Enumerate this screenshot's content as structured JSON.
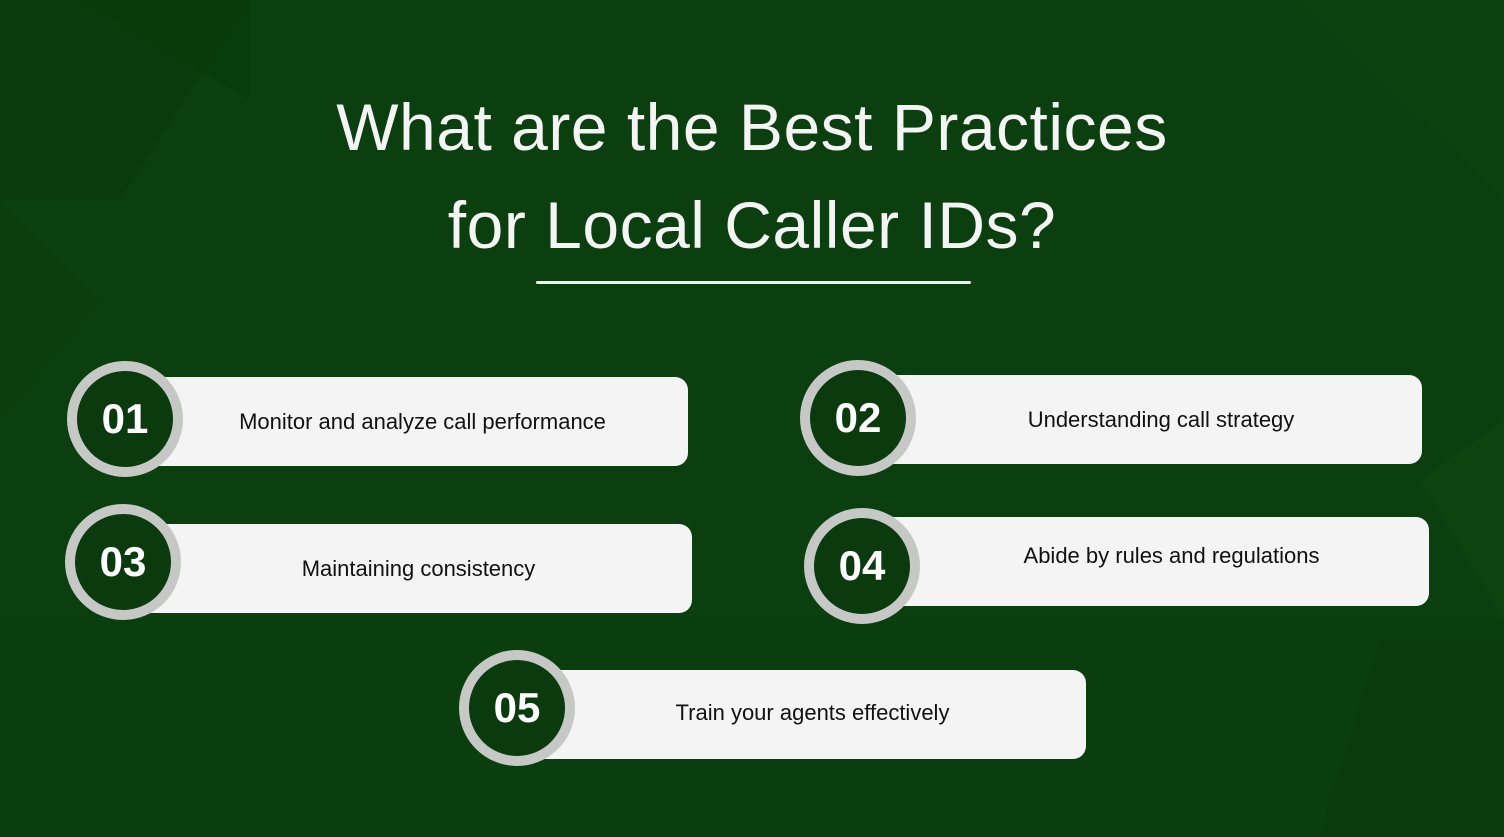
{
  "title_line1": "What are the Best Practices",
  "title_line2": "for Local Caller IDs?",
  "colors": {
    "background": "#0c3f0f",
    "badge_fill": "#0b3a0e",
    "badge_ring": "#c6c8c6",
    "card": "#f4f4f4",
    "title": "#f4f4f4"
  },
  "practices": [
    {
      "number": "01",
      "label": "Monitor and analyze call performance"
    },
    {
      "number": "02",
      "label": "Understanding call strategy"
    },
    {
      "number": "03",
      "label": "Maintaining consistency"
    },
    {
      "number": "04",
      "label": "Abide by rules and regulations"
    },
    {
      "number": "05",
      "label": "Train your agents effectively"
    }
  ]
}
